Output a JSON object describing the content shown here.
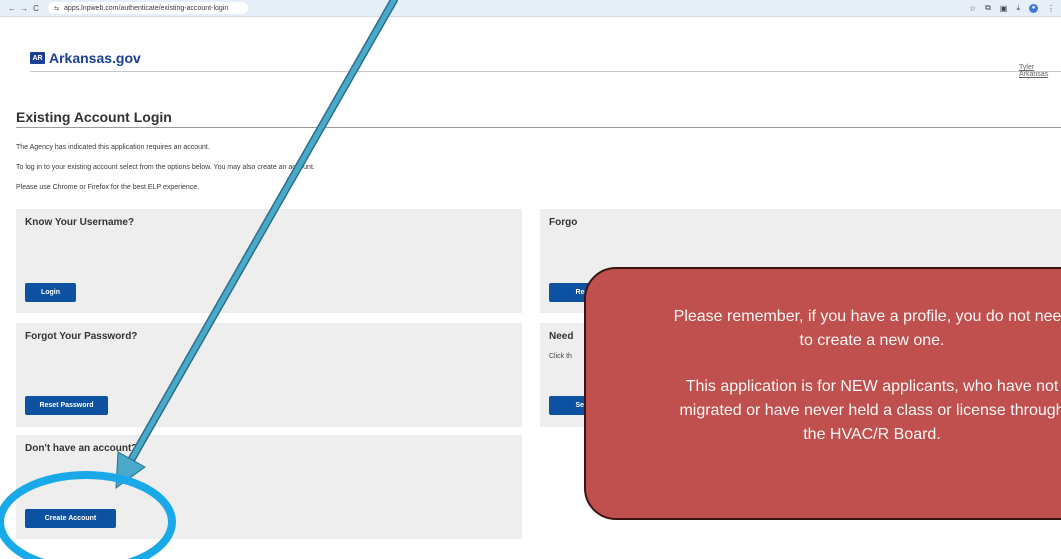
{
  "browser": {
    "back": "←",
    "forward": "→",
    "reload": "C",
    "site_info": "⇆",
    "url": "apps.lnpweb.com/authenticate/existing-account-login",
    "icons": [
      "star-icon",
      "extensions-icon",
      "split-screen-icon",
      "download-icon",
      "profile-icon",
      "menu-icon"
    ]
  },
  "header": {
    "logo_badge": "AR",
    "logo_text": "Arkansas.gov",
    "user_name": "Tyler Arkansas"
  },
  "page": {
    "title": "Existing Account Login",
    "intro": [
      "The Agency has indicated this application requires an account.",
      "To log in to your existing account select from the options below. You may also create an account.",
      "Please use Chrome or Firefox for the best ELP experience."
    ]
  },
  "cards": {
    "know_username": {
      "title": "Know Your Username?",
      "button": "Login"
    },
    "forgot_password": {
      "title": "Forgot Your Password?",
      "button": "Reset Password"
    },
    "no_account": {
      "title": "Don't have an account?",
      "button": "Create Account"
    },
    "forgot_username": {
      "title": "Forgo",
      "button": "Reco"
    },
    "need_help": {
      "title": "Need",
      "text": "Click th",
      "button": "Send"
    }
  },
  "overlay": {
    "line1": "Please remember, if you have a profile, you do not need",
    "line2": "to create a new one.",
    "line3": "This application is for NEW applicants, who have not",
    "line4": "migrated or have never held a class or license through",
    "line5": "the HVAC/R Board."
  },
  "colors": {
    "button_blue": "#0d52a1",
    "overlay_red": "#c0504d",
    "annotation_cyan": "#4aa8c9",
    "circle_blue": "#1aa9e8",
    "logo_blue": "#1c3f94"
  }
}
